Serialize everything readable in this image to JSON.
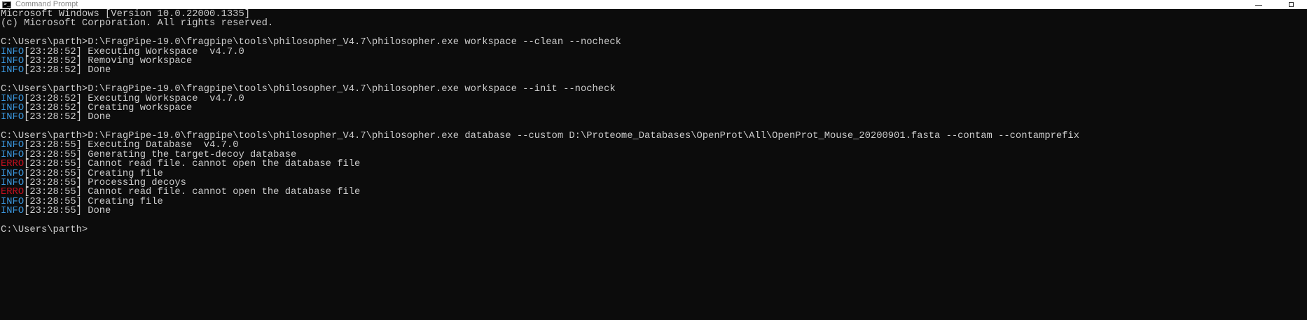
{
  "window": {
    "title": "Command Prompt",
    "app_icon": "cmd-icon",
    "controls": {
      "minimize_icon": "minimize-icon",
      "maximize_icon": "maximize-icon"
    }
  },
  "colors": {
    "background": "#0c0c0c",
    "text": "#cccccc",
    "info": "#3a96dd",
    "error": "#c50f1f"
  },
  "console": {
    "header": [
      "Microsoft Windows [Version 10.0.22000.1335]",
      "(c) Microsoft Corporation. All rights reserved."
    ],
    "commands": [
      {
        "prompt": "C:\\Users\\parth>",
        "command": "D:\\FragPipe-19.0\\fragpipe\\tools\\philosopher_V4.7\\philosopher.exe workspace --clean --nocheck",
        "output": [
          {
            "level": "INFO",
            "time": "[23:28:52]",
            "msg": " Executing Workspace  v4.7.0"
          },
          {
            "level": "INFO",
            "time": "[23:28:52]",
            "msg": " Removing workspace"
          },
          {
            "level": "INFO",
            "time": "[23:28:52]",
            "msg": " Done"
          }
        ]
      },
      {
        "prompt": "C:\\Users\\parth>",
        "command": "D:\\FragPipe-19.0\\fragpipe\\tools\\philosopher_V4.7\\philosopher.exe workspace --init --nocheck",
        "output": [
          {
            "level": "INFO",
            "time": "[23:28:52]",
            "msg": " Executing Workspace  v4.7.0"
          },
          {
            "level": "INFO",
            "time": "[23:28:52]",
            "msg": " Creating workspace"
          },
          {
            "level": "INFO",
            "time": "[23:28:52]",
            "msg": " Done"
          }
        ]
      },
      {
        "prompt": "C:\\Users\\parth>",
        "command": "D:\\FragPipe-19.0\\fragpipe\\tools\\philosopher_V4.7\\philosopher.exe database --custom D:\\Proteome_Databases\\OpenProt\\All\\OpenProt_Mouse_20200901.fasta --contam --contamprefix",
        "output": [
          {
            "level": "INFO",
            "time": "[23:28:55]",
            "msg": " Executing Database  v4.7.0"
          },
          {
            "level": "INFO",
            "time": "[23:28:55]",
            "msg": " Generating the target-decoy database"
          },
          {
            "level": "ERRO",
            "time": "[23:28:55]",
            "msg": " Cannot read file. cannot open the database file"
          },
          {
            "level": "INFO",
            "time": "[23:28:55]",
            "msg": " Creating file"
          },
          {
            "level": "INFO",
            "time": "[23:28:55]",
            "msg": " Processing decoys"
          },
          {
            "level": "ERRO",
            "time": "[23:28:55]",
            "msg": " Cannot read file. cannot open the database file"
          },
          {
            "level": "INFO",
            "time": "[23:28:55]",
            "msg": " Creating file"
          },
          {
            "level": "INFO",
            "time": "[23:28:55]",
            "msg": " Done"
          }
        ]
      }
    ],
    "final_prompt": "C:\\Users\\parth>"
  }
}
